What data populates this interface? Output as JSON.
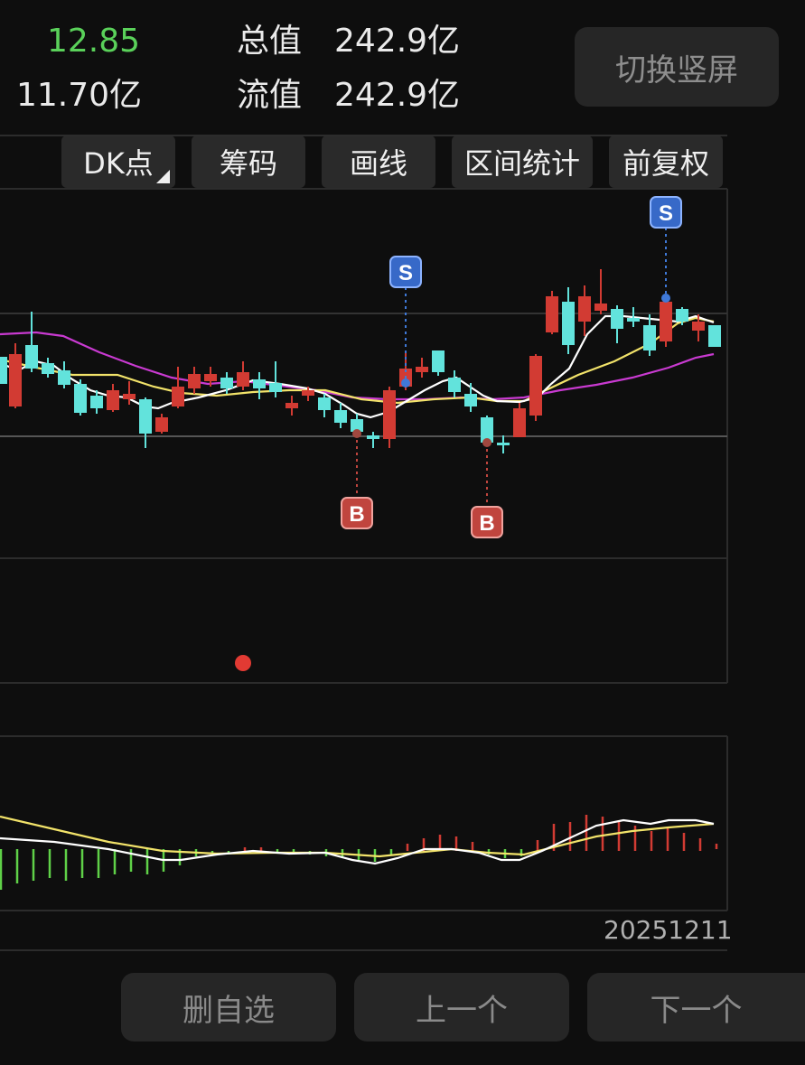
{
  "header": {
    "price": "12.85",
    "amount": "11.70亿",
    "total_value_label": "总值",
    "total_value": "242.9亿",
    "float_value_label": "流值",
    "float_value": "242.9亿",
    "switch_button": "切换竖屏"
  },
  "toolbar": {
    "dk": "DK点",
    "chips": "筹码",
    "draw": "画线",
    "range": "区间统计",
    "adjust": "前复权"
  },
  "markers": {
    "sell": "S",
    "buy": "B"
  },
  "date_label": "20251211",
  "footer": {
    "delete": "删自选",
    "prev": "上一个",
    "next": "下一个"
  },
  "colors": {
    "up": "#d23b33",
    "down": "#62e3dc",
    "ma_white": "#ffffff",
    "ma_yellow": "#f2e36a",
    "ma_purple": "#c93ad1",
    "sell_badge": "#3769c8",
    "buy_badge": "#c0453e"
  }
}
